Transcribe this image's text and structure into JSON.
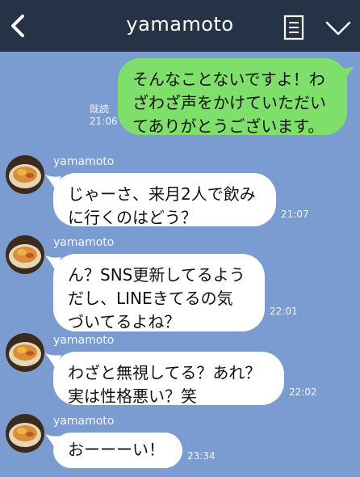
{
  "header": {
    "title": "yamamoto",
    "icons": {
      "back": "chevron-left-icon",
      "menu": "note-icon",
      "collapse": "chevron-down-icon"
    }
  },
  "colors": {
    "header_bg": "#263246",
    "chat_bg": "#7b9cd1",
    "outgoing_bubble": "#7ee06a",
    "incoming_bubble": "#ffffff"
  },
  "messages": [
    {
      "direction": "outgoing",
      "lines": [
        "そんなことないですよ！わ",
        "ざわざ声をかけていただい",
        "てありがとうございます。"
      ],
      "read_label": "既読",
      "time": "21:06"
    },
    {
      "direction": "incoming",
      "sender": "yamamoto",
      "lines": [
        "じゃーさ、来月2人で飲み",
        "に行くのはどう？"
      ],
      "time": "21:07"
    },
    {
      "direction": "incoming",
      "sender": "yamamoto",
      "lines": [
        "ん？SNS更新してるよう",
        "だし、LINEきてるの気",
        "づいてるよね？"
      ],
      "time": "22:01"
    },
    {
      "direction": "incoming",
      "sender": "yamamoto",
      "lines": [
        "わざと無視してる？あれ？",
        "実は性格悪い？笑"
      ],
      "time": "22:02"
    },
    {
      "direction": "incoming",
      "sender": "yamamoto",
      "lines": [
        "おーーーい！"
      ],
      "time": "23:34"
    }
  ]
}
